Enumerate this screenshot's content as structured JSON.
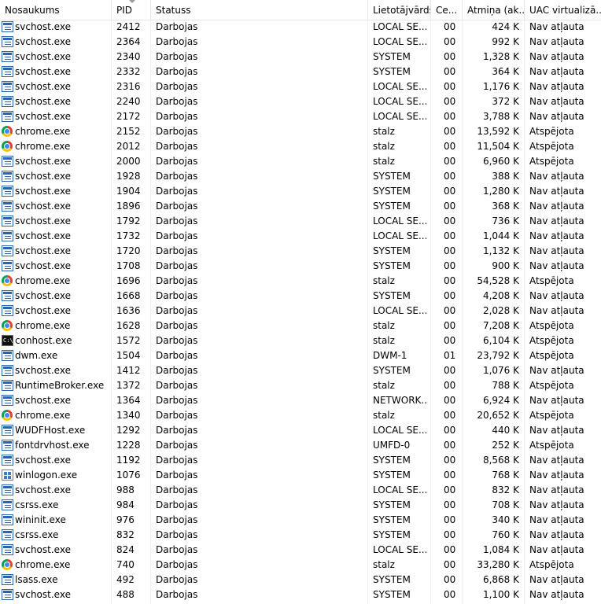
{
  "headers": {
    "name": "Nosaukums",
    "pid": "PID",
    "status": "Statuss",
    "user": "Lietotājvārds",
    "cpu": "Ce...",
    "memory": "Atmiņa (ak...",
    "uac": "UAC virtualizā..."
  },
  "rows": [
    {
      "icon": "service-icon",
      "name": "svchost.exe",
      "pid": "2412",
      "status": "Darbojas",
      "user": "LOCAL SE...",
      "cpu": "00",
      "memory": "424 K",
      "uac": "Nav atļauta"
    },
    {
      "icon": "service-icon",
      "name": "svchost.exe",
      "pid": "2364",
      "status": "Darbojas",
      "user": "LOCAL SE...",
      "cpu": "00",
      "memory": "992 K",
      "uac": "Nav atļauta"
    },
    {
      "icon": "service-icon",
      "name": "svchost.exe",
      "pid": "2340",
      "status": "Darbojas",
      "user": "SYSTEM",
      "cpu": "00",
      "memory": "1,328 K",
      "uac": "Nav atļauta"
    },
    {
      "icon": "service-icon",
      "name": "svchost.exe",
      "pid": "2332",
      "status": "Darbojas",
      "user": "SYSTEM",
      "cpu": "00",
      "memory": "364 K",
      "uac": "Nav atļauta"
    },
    {
      "icon": "service-icon",
      "name": "svchost.exe",
      "pid": "2316",
      "status": "Darbojas",
      "user": "LOCAL SE...",
      "cpu": "00",
      "memory": "1,176 K",
      "uac": "Nav atļauta"
    },
    {
      "icon": "service-icon",
      "name": "svchost.exe",
      "pid": "2240",
      "status": "Darbojas",
      "user": "LOCAL SE...",
      "cpu": "00",
      "memory": "372 K",
      "uac": "Nav atļauta"
    },
    {
      "icon": "service-icon",
      "name": "svchost.exe",
      "pid": "2172",
      "status": "Darbojas",
      "user": "LOCAL SE...",
      "cpu": "00",
      "memory": "3,788 K",
      "uac": "Nav atļauta"
    },
    {
      "icon": "chrome-icon",
      "name": "chrome.exe",
      "pid": "2152",
      "status": "Darbojas",
      "user": "stalz",
      "cpu": "00",
      "memory": "13,592 K",
      "uac": "Atspējota"
    },
    {
      "icon": "chrome-icon",
      "name": "chrome.exe",
      "pid": "2012",
      "status": "Darbojas",
      "user": "stalz",
      "cpu": "00",
      "memory": "11,504 K",
      "uac": "Atspējota"
    },
    {
      "icon": "service-icon",
      "name": "svchost.exe",
      "pid": "2000",
      "status": "Darbojas",
      "user": "stalz",
      "cpu": "00",
      "memory": "6,960 K",
      "uac": "Atspējota"
    },
    {
      "icon": "service-icon",
      "name": "svchost.exe",
      "pid": "1928",
      "status": "Darbojas",
      "user": "SYSTEM",
      "cpu": "00",
      "memory": "388 K",
      "uac": "Nav atļauta"
    },
    {
      "icon": "service-icon",
      "name": "svchost.exe",
      "pid": "1904",
      "status": "Darbojas",
      "user": "SYSTEM",
      "cpu": "00",
      "memory": "1,280 K",
      "uac": "Nav atļauta"
    },
    {
      "icon": "service-icon",
      "name": "svchost.exe",
      "pid": "1896",
      "status": "Darbojas",
      "user": "SYSTEM",
      "cpu": "00",
      "memory": "368 K",
      "uac": "Nav atļauta"
    },
    {
      "icon": "service-icon",
      "name": "svchost.exe",
      "pid": "1792",
      "status": "Darbojas",
      "user": "LOCAL SE...",
      "cpu": "00",
      "memory": "736 K",
      "uac": "Nav atļauta"
    },
    {
      "icon": "service-icon",
      "name": "svchost.exe",
      "pid": "1732",
      "status": "Darbojas",
      "user": "LOCAL SE...",
      "cpu": "00",
      "memory": "1,044 K",
      "uac": "Nav atļauta"
    },
    {
      "icon": "service-icon",
      "name": "svchost.exe",
      "pid": "1720",
      "status": "Darbojas",
      "user": "SYSTEM",
      "cpu": "00",
      "memory": "1,132 K",
      "uac": "Nav atļauta"
    },
    {
      "icon": "service-icon",
      "name": "svchost.exe",
      "pid": "1708",
      "status": "Darbojas",
      "user": "SYSTEM",
      "cpu": "00",
      "memory": "900 K",
      "uac": "Nav atļauta"
    },
    {
      "icon": "chrome-icon",
      "name": "chrome.exe",
      "pid": "1696",
      "status": "Darbojas",
      "user": "stalz",
      "cpu": "00",
      "memory": "54,528 K",
      "uac": "Atspējota"
    },
    {
      "icon": "service-icon",
      "name": "svchost.exe",
      "pid": "1668",
      "status": "Darbojas",
      "user": "SYSTEM",
      "cpu": "00",
      "memory": "4,208 K",
      "uac": "Nav atļauta"
    },
    {
      "icon": "service-icon",
      "name": "svchost.exe",
      "pid": "1636",
      "status": "Darbojas",
      "user": "LOCAL SE...",
      "cpu": "00",
      "memory": "2,028 K",
      "uac": "Nav atļauta"
    },
    {
      "icon": "chrome-icon",
      "name": "chrome.exe",
      "pid": "1628",
      "status": "Darbojas",
      "user": "stalz",
      "cpu": "00",
      "memory": "7,208 K",
      "uac": "Atspējota"
    },
    {
      "icon": "console-icon",
      "name": "conhost.exe",
      "pid": "1572",
      "status": "Darbojas",
      "user": "stalz",
      "cpu": "00",
      "memory": "6,104 K",
      "uac": "Atspējota"
    },
    {
      "icon": "service-icon",
      "name": "dwm.exe",
      "pid": "1504",
      "status": "Darbojas",
      "user": "DWM-1",
      "cpu": "01",
      "memory": "23,792 K",
      "uac": "Atspējota"
    },
    {
      "icon": "service-icon",
      "name": "svchost.exe",
      "pid": "1412",
      "status": "Darbojas",
      "user": "SYSTEM",
      "cpu": "00",
      "memory": "1,076 K",
      "uac": "Nav atļauta"
    },
    {
      "icon": "service-icon",
      "name": "RuntimeBroker.exe",
      "pid": "1372",
      "status": "Darbojas",
      "user": "stalz",
      "cpu": "00",
      "memory": "788 K",
      "uac": "Atspējota"
    },
    {
      "icon": "service-icon",
      "name": "svchost.exe",
      "pid": "1364",
      "status": "Darbojas",
      "user": "NETWORK...",
      "cpu": "00",
      "memory": "6,924 K",
      "uac": "Nav atļauta"
    },
    {
      "icon": "chrome-icon",
      "name": "chrome.exe",
      "pid": "1340",
      "status": "Darbojas",
      "user": "stalz",
      "cpu": "00",
      "memory": "20,652 K",
      "uac": "Atspējota"
    },
    {
      "icon": "service-icon",
      "name": "WUDFHost.exe",
      "pid": "1292",
      "status": "Darbojas",
      "user": "LOCAL SE...",
      "cpu": "00",
      "memory": "440 K",
      "uac": "Nav atļauta"
    },
    {
      "icon": "service-icon",
      "name": "fontdrvhost.exe",
      "pid": "1228",
      "status": "Darbojas",
      "user": "UMFD-0",
      "cpu": "00",
      "memory": "252 K",
      "uac": "Atspējota"
    },
    {
      "icon": "service-icon",
      "name": "svchost.exe",
      "pid": "1192",
      "status": "Darbojas",
      "user": "SYSTEM",
      "cpu": "00",
      "memory": "8,568 K",
      "uac": "Nav atļauta"
    },
    {
      "icon": "winlogon-icon",
      "name": "winlogon.exe",
      "pid": "1076",
      "status": "Darbojas",
      "user": "SYSTEM",
      "cpu": "00",
      "memory": "768 K",
      "uac": "Nav atļauta"
    },
    {
      "icon": "service-icon",
      "name": "svchost.exe",
      "pid": "988",
      "status": "Darbojas",
      "user": "LOCAL SE...",
      "cpu": "00",
      "memory": "832 K",
      "uac": "Nav atļauta"
    },
    {
      "icon": "service-icon",
      "name": "csrss.exe",
      "pid": "984",
      "status": "Darbojas",
      "user": "SYSTEM",
      "cpu": "00",
      "memory": "708 K",
      "uac": "Nav atļauta"
    },
    {
      "icon": "service-icon",
      "name": "wininit.exe",
      "pid": "976",
      "status": "Darbojas",
      "user": "SYSTEM",
      "cpu": "00",
      "memory": "340 K",
      "uac": "Nav atļauta"
    },
    {
      "icon": "service-icon",
      "name": "csrss.exe",
      "pid": "832",
      "status": "Darbojas",
      "user": "SYSTEM",
      "cpu": "00",
      "memory": "760 K",
      "uac": "Nav atļauta"
    },
    {
      "icon": "service-icon",
      "name": "svchost.exe",
      "pid": "824",
      "status": "Darbojas",
      "user": "LOCAL SE...",
      "cpu": "00",
      "memory": "1,084 K",
      "uac": "Nav atļauta"
    },
    {
      "icon": "chrome-icon",
      "name": "chrome.exe",
      "pid": "740",
      "status": "Darbojas",
      "user": "stalz",
      "cpu": "00",
      "memory": "33,280 K",
      "uac": "Atspējota"
    },
    {
      "icon": "service-icon",
      "name": "lsass.exe",
      "pid": "492",
      "status": "Darbojas",
      "user": "SYSTEM",
      "cpu": "00",
      "memory": "6,868 K",
      "uac": "Nav atļauta"
    },
    {
      "icon": "service-icon",
      "name": "svchost.exe",
      "pid": "488",
      "status": "Darbojas",
      "user": "SYSTEM",
      "cpu": "00",
      "memory": "1,100 K",
      "uac": "Nav atļauta"
    }
  ]
}
